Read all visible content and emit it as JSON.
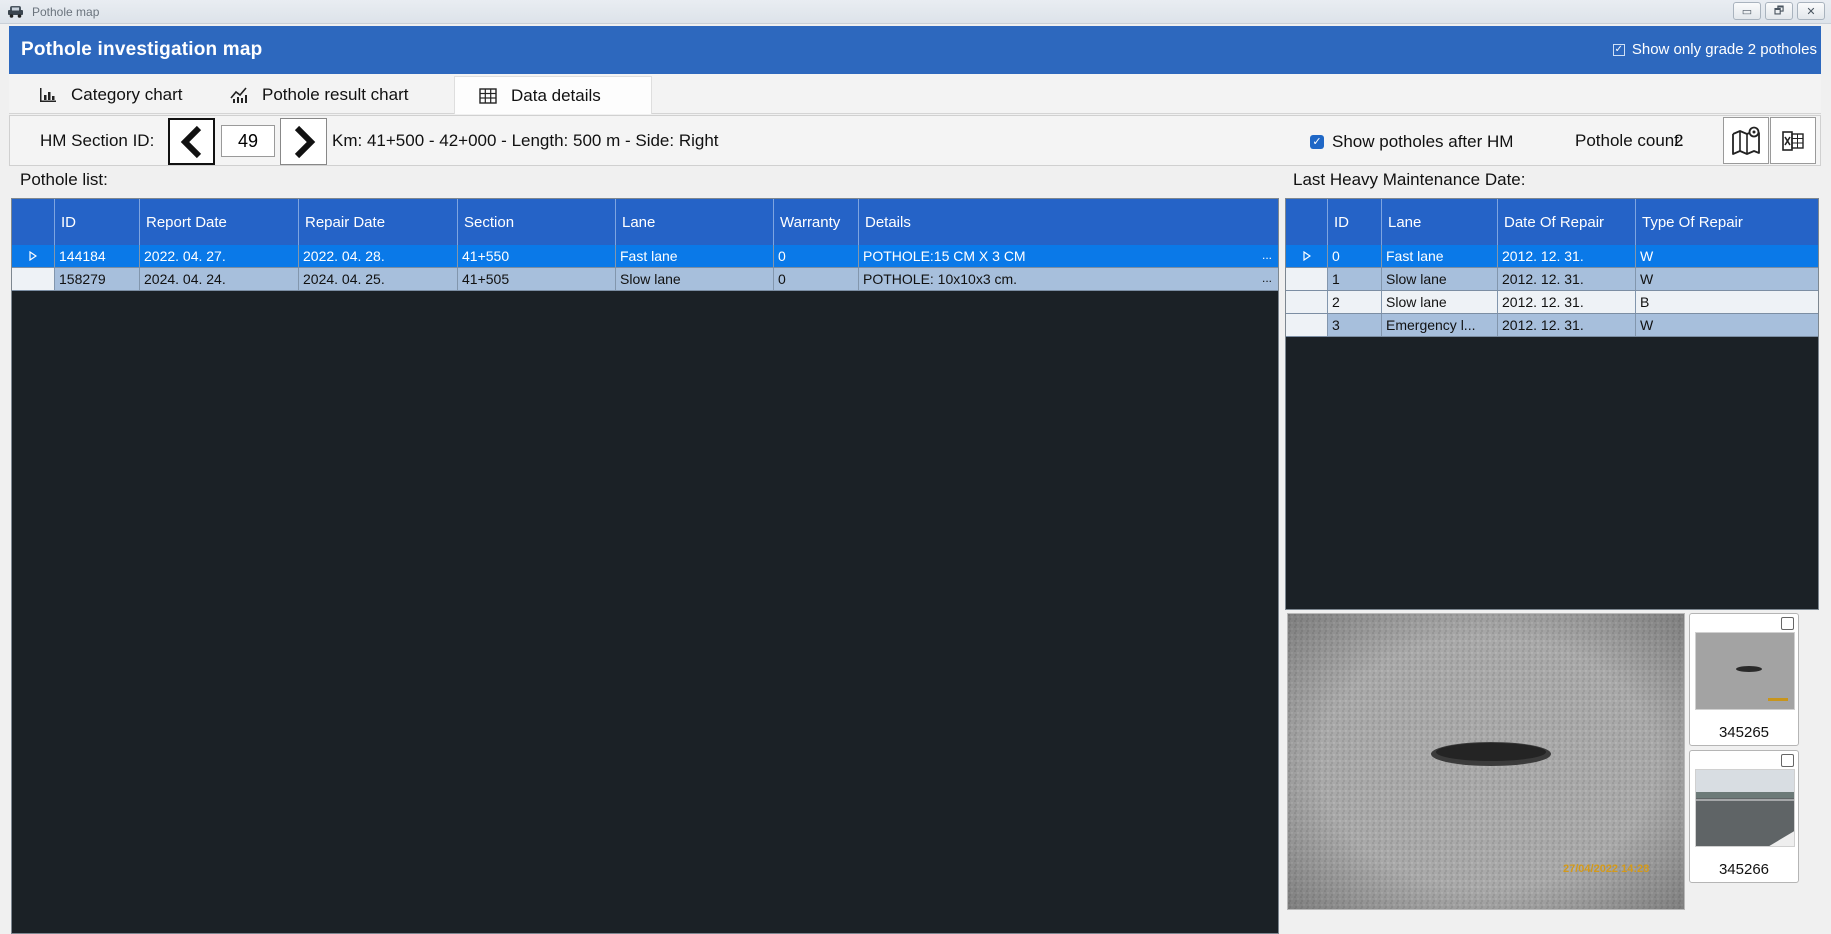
{
  "window": {
    "title": "Pothole map",
    "controls": [
      "▭",
      "🗗",
      "✕"
    ]
  },
  "header": {
    "title": "Pothole investigation map",
    "grade_filter_label": "Show only grade 2 potholes",
    "grade_filter_checked": true
  },
  "tabs": [
    {
      "label": "Category chart",
      "icon": "bar-chart-icon"
    },
    {
      "label": "Pothole result chart",
      "icon": "trend-chart-icon"
    },
    {
      "label": "Data details",
      "icon": "table-icon",
      "active": true
    }
  ],
  "toolbar": {
    "hm_label": "HM Section ID:",
    "hm_value": "49",
    "km_info": "Km: 41+500 - 42+000 - Length: 500 m  - Side: Right",
    "show_after_hm_label": "Show potholes after HM",
    "show_after_hm_checked": true,
    "pothole_count_label": "Pothole count:",
    "pothole_count_value": "2"
  },
  "pothole_list": {
    "label": "Pothole list:",
    "columns": [
      "ID",
      "Report Date",
      "Repair Date",
      "Section",
      "Lane",
      "Warranty",
      "Details"
    ],
    "rows": [
      {
        "id": "144184",
        "report_date": "2022. 04. 27.",
        "repair_date": "2022. 04. 28.",
        "section": "41+550",
        "lane": "Fast lane",
        "warranty": "0",
        "details": "POTHOLE:15 CM X 3 CM",
        "selected": true
      },
      {
        "id": "158279",
        "report_date": "2024. 04. 24.",
        "repair_date": "2024. 04. 25.",
        "section": "41+505",
        "lane": "Slow lane",
        "warranty": "0",
        "details": "POTHOLE: 10x10x3 cm.",
        "selected": false
      }
    ],
    "details_more": "..."
  },
  "maintenance": {
    "label": "Last Heavy Maintenance Date:",
    "columns": [
      "ID",
      "Lane",
      "Date Of Repair",
      "Type Of Repair"
    ],
    "rows": [
      {
        "id": "0",
        "lane": "Fast lane",
        "date": "2012. 12. 31.",
        "type": "W",
        "selected": true
      },
      {
        "id": "1",
        "lane": "Slow lane",
        "date": "2012. 12. 31.",
        "type": "W"
      },
      {
        "id": "2",
        "lane": "Slow lane",
        "date": "2012. 12. 31.",
        "type": "B"
      },
      {
        "id": "3",
        "lane": "Emergency l...",
        "date": "2012. 12. 31.",
        "type": "W"
      }
    ]
  },
  "photos": {
    "main_timestamp": "27/04/2022 14:28",
    "thumbnails": [
      {
        "label": "345265",
        "checked": false
      },
      {
        "label": "345266",
        "checked": false
      }
    ]
  },
  "colors": {
    "header_blue": "#2d68be",
    "grid_header": "#2563c7",
    "grid_background": "#1b2126",
    "row_selected": "#0a79e8",
    "row_normal": "#a7bfdc"
  }
}
